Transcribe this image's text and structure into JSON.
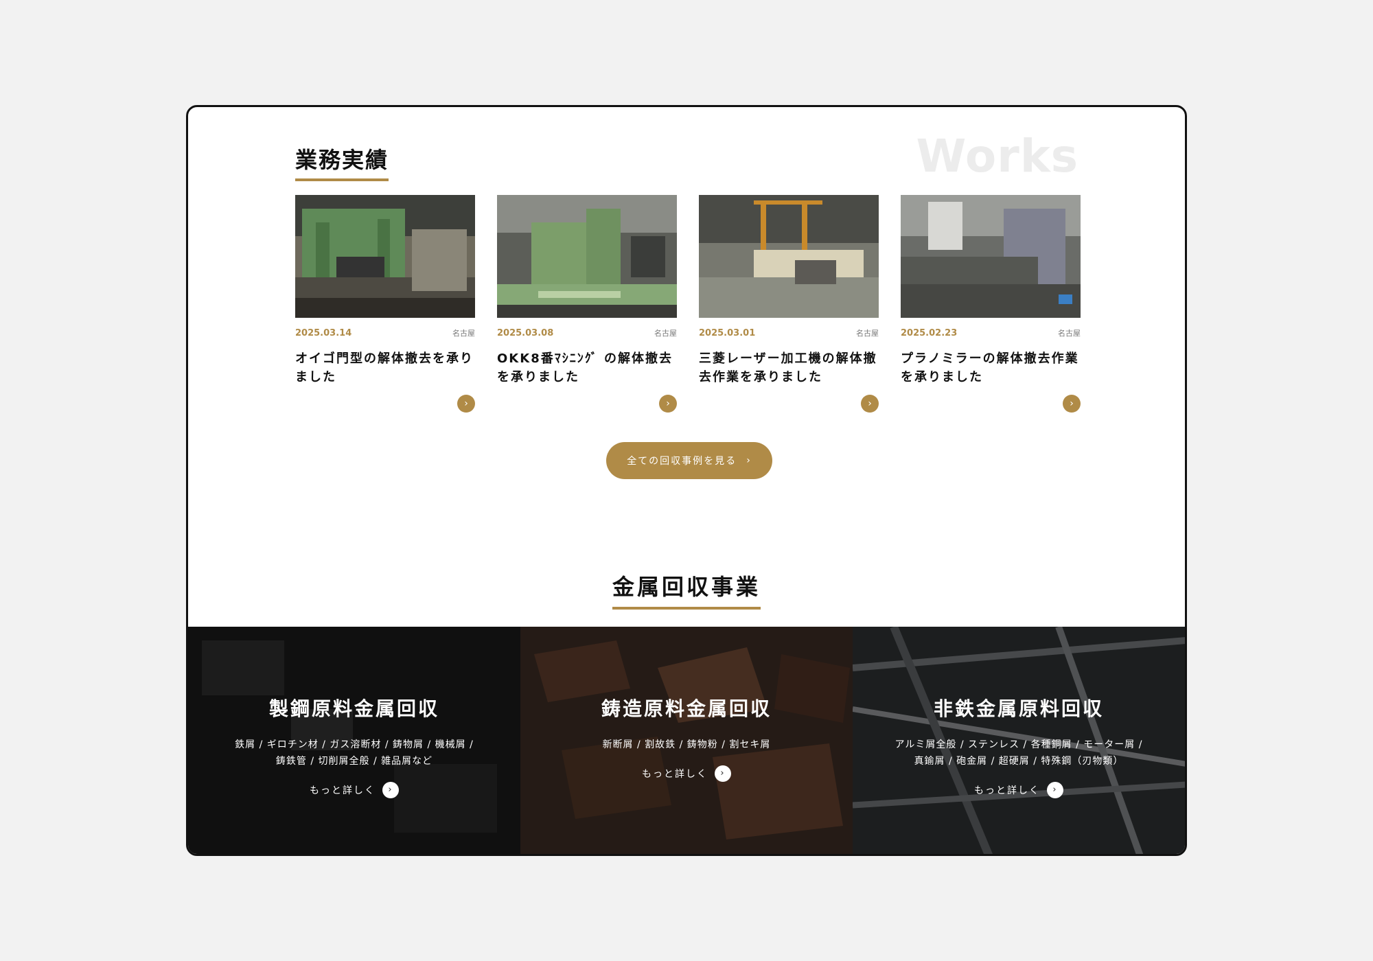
{
  "works": {
    "title": "業務実績",
    "watermark": "Works",
    "cards": [
      {
        "date": "2025.03.14",
        "location": "名古屋",
        "title": "オイゴ門型の解体撤去を承りました"
      },
      {
        "date": "2025.03.08",
        "location": "名古屋",
        "title": "OKK8番ﾏｼﾆﾝｸﾞ の解体撤去を承りました"
      },
      {
        "date": "2025.03.01",
        "location": "名古屋",
        "title": "三菱レーザー加工機の解体撤去作業を承りました"
      },
      {
        "date": "2025.02.23",
        "location": "名古屋",
        "title": "プラノミラーの解体撤去作業を承りました"
      }
    ],
    "all_button_label": "全ての回収事例を見る",
    "arrow": "›"
  },
  "recycling": {
    "title": "金属回収事業",
    "panels": [
      {
        "title": "製鋼原料金属回収",
        "desc_line1": "鉄屑 / ギロチン材 / ガス溶断材 / 鋳物屑 / 機械屑 /",
        "desc_line2": "鋳鉄管 / 切削屑全般 / 雑品屑など",
        "more": "もっと詳しく"
      },
      {
        "title": "鋳造原料金属回収",
        "desc_line1": "新断屑 / 割故鉄 / 鋳物粉 / 割セキ屑",
        "desc_line2": "",
        "more": "もっと詳しく"
      },
      {
        "title": "非鉄金属原料回収",
        "desc_line1": "アルミ屑全般 / ステンレス / 各種銅屑 / モーター屑 /",
        "desc_line2": "真鍮屑 / 砲金屑 / 超硬屑 / 特殊鋼（刃物類）",
        "more": "もっと詳しく"
      }
    ]
  },
  "colors": {
    "accent": "#b08b47",
    "frame": "#111111",
    "background": "#f2f2f2"
  }
}
